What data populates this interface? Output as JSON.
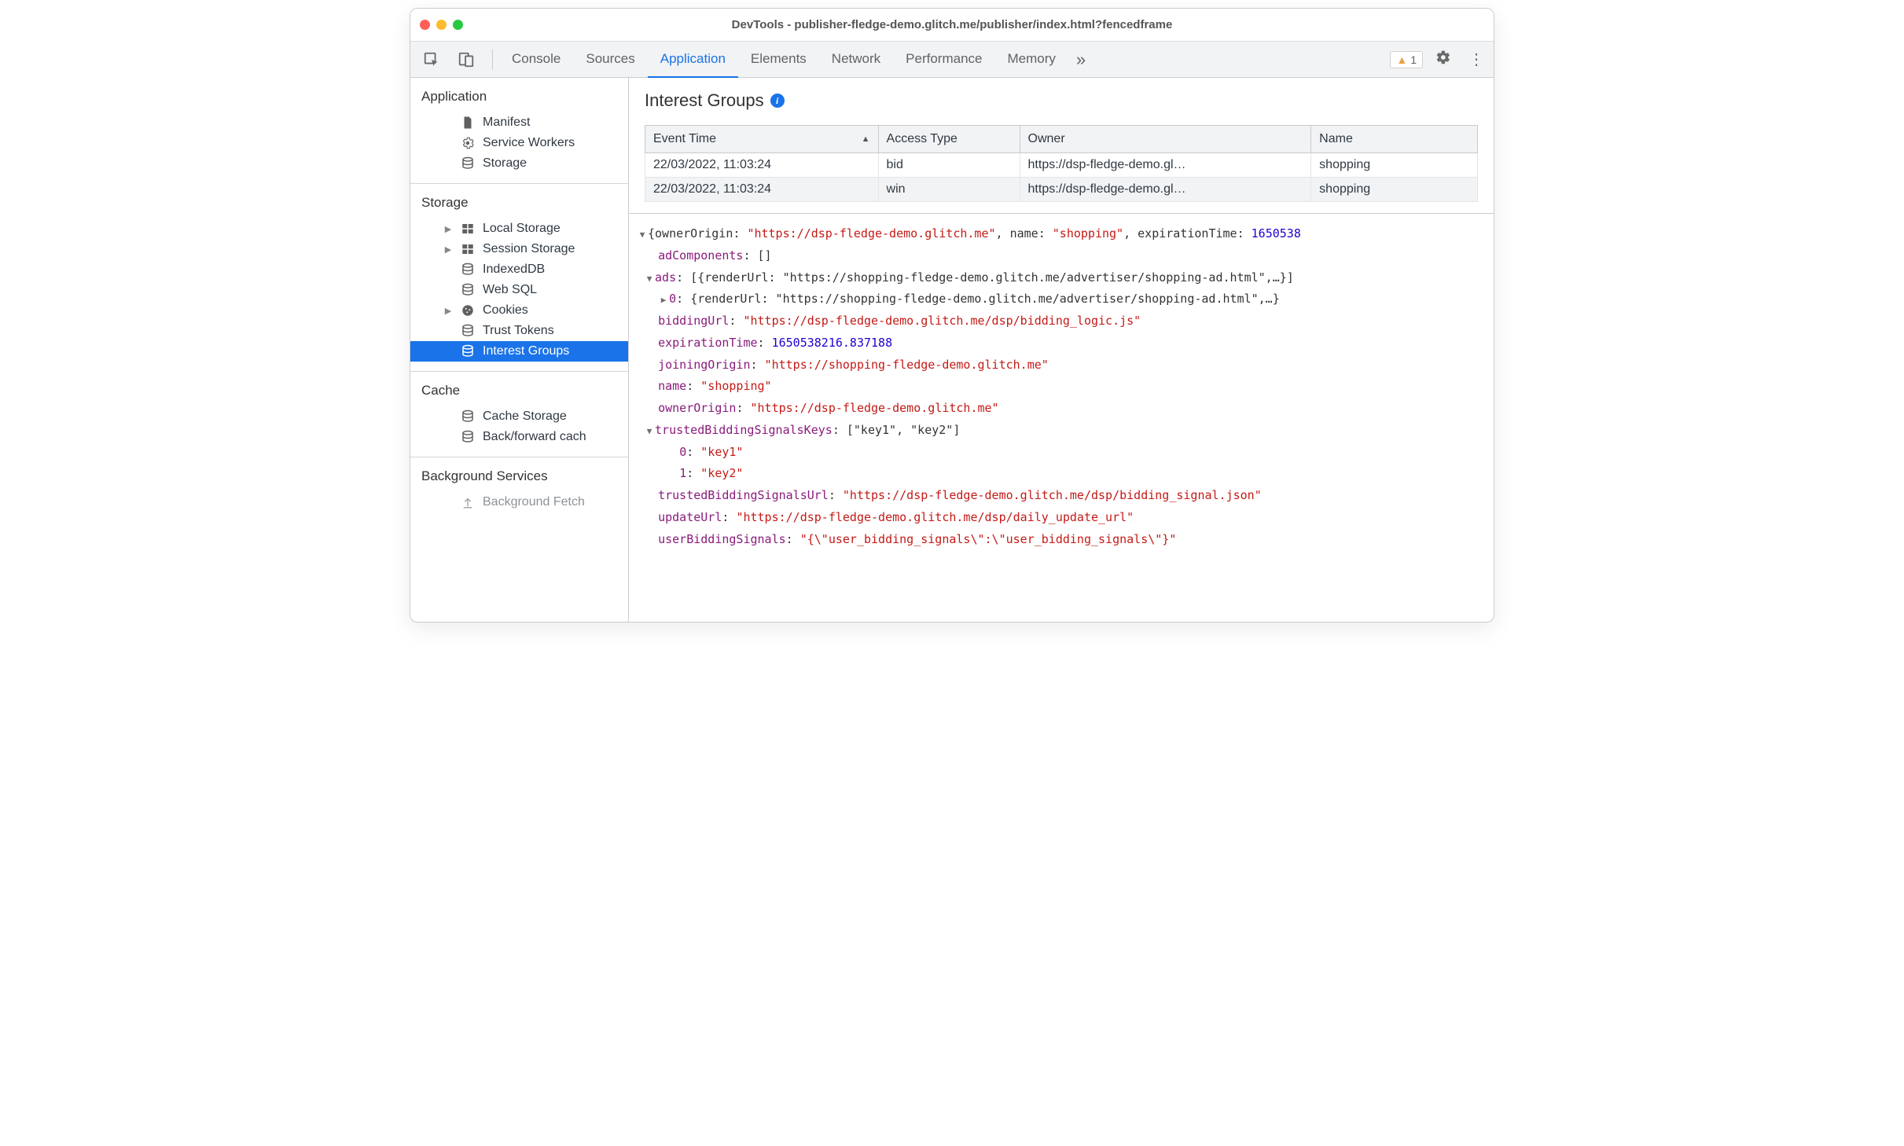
{
  "window": {
    "title": "DevTools - publisher-fledge-demo.glitch.me/publisher/index.html?fencedframe"
  },
  "toolbar": {
    "tabs": [
      "Console",
      "Sources",
      "Application",
      "Elements",
      "Network",
      "Performance",
      "Memory"
    ],
    "active_tab_index": 2,
    "more_tabs_glyph": "»",
    "warning_count": "1"
  },
  "sidebar": {
    "sections": [
      {
        "heading": "Application",
        "items": [
          {
            "label": "Manifest",
            "icon": "file",
            "expandable": false
          },
          {
            "label": "Service Workers",
            "icon": "gear",
            "expandable": false
          },
          {
            "label": "Storage",
            "icon": "db",
            "expandable": false
          }
        ]
      },
      {
        "heading": "Storage",
        "items": [
          {
            "label": "Local Storage",
            "icon": "grid",
            "expandable": true
          },
          {
            "label": "Session Storage",
            "icon": "grid",
            "expandable": true
          },
          {
            "label": "IndexedDB",
            "icon": "db",
            "expandable": false
          },
          {
            "label": "Web SQL",
            "icon": "db",
            "expandable": false
          },
          {
            "label": "Cookies",
            "icon": "cookie",
            "expandable": true
          },
          {
            "label": "Trust Tokens",
            "icon": "db",
            "expandable": false
          },
          {
            "label": "Interest Groups",
            "icon": "db",
            "expandable": false,
            "selected": true
          }
        ]
      },
      {
        "heading": "Cache",
        "items": [
          {
            "label": "Cache Storage",
            "icon": "db",
            "expandable": false
          },
          {
            "label": "Back/forward cach",
            "icon": "db",
            "expandable": false
          }
        ]
      },
      {
        "heading": "Background Services",
        "items": [
          {
            "label": "Background Fetch",
            "icon": "upload",
            "expandable": false,
            "faded": true
          }
        ]
      }
    ]
  },
  "panel": {
    "title": "Interest Groups",
    "columns": [
      "Event Time",
      "Access Type",
      "Owner",
      "Name"
    ],
    "sort_column_index": 0,
    "rows": [
      {
        "time": "22/03/2022, 11:03:24",
        "access": "bid",
        "owner": "https://dsp-fledge-demo.gl…",
        "name": "shopping"
      },
      {
        "time": "22/03/2022, 11:03:24",
        "access": "win",
        "owner": "https://dsp-fledge-demo.gl…",
        "name": "shopping"
      }
    ]
  },
  "detail": {
    "summary_prefix": "{ownerOrigin: ",
    "summary_owner": "\"https://dsp-fledge-demo.glitch.me\"",
    "summary_mid1": ", name: ",
    "summary_name": "\"shopping\"",
    "summary_mid2": ", expirationTime: ",
    "summary_exp": "1650538",
    "adComponents_key": "adComponents",
    "adComponents_val": "[]",
    "ads_key": "ads",
    "ads_summary": "[{renderUrl: \"https://shopping-fledge-demo.glitch.me/advertiser/shopping-ad.html\",…}]",
    "ads0_summary": "{renderUrl: \"https://shopping-fledge-demo.glitch.me/advertiser/shopping-ad.html\",…}",
    "biddingUrl_key": "biddingUrl",
    "biddingUrl_val": "\"https://dsp-fledge-demo.glitch.me/dsp/bidding_logic.js\"",
    "expirationTime_key": "expirationTime",
    "expirationTime_val": "1650538216.837188",
    "joiningOrigin_key": "joiningOrigin",
    "joiningOrigin_val": "\"https://shopping-fledge-demo.glitch.me\"",
    "name_key": "name",
    "name_val": "\"shopping\"",
    "ownerOrigin_key": "ownerOrigin",
    "ownerOrigin_val": "\"https://dsp-fledge-demo.glitch.me\"",
    "tbsk_key": "trustedBiddingSignalsKeys",
    "tbsk_summary": "[\"key1\", \"key2\"]",
    "tbsk_0": "\"key1\"",
    "tbsk_1": "\"key2\"",
    "tbsUrl_key": "trustedBiddingSignalsUrl",
    "tbsUrl_val": "\"https://dsp-fledge-demo.glitch.me/dsp/bidding_signal.json\"",
    "updateUrl_key": "updateUrl",
    "updateUrl_val": "\"https://dsp-fledge-demo.glitch.me/dsp/daily_update_url\"",
    "ubs_key": "userBiddingSignals",
    "ubs_val": "\"{\\\"user_bidding_signals\\\":\\\"user_bidding_signals\\\"}\""
  }
}
